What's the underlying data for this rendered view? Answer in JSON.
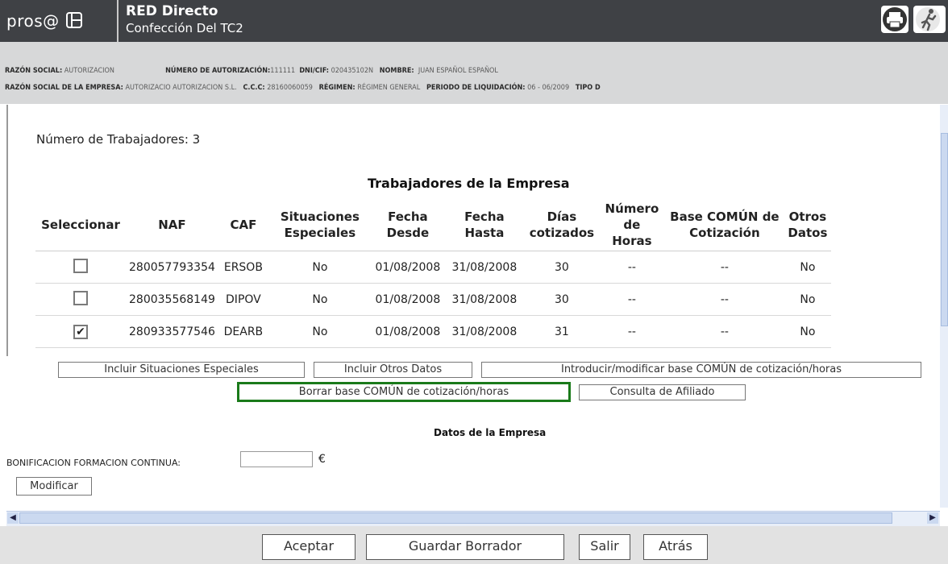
{
  "header": {
    "logo_text": "pros@",
    "title": "RED Directo",
    "subtitle": "Confección Del TC2"
  },
  "info": {
    "razon_social_label": "RAZÓN SOCIAL:",
    "razon_social_value": "AUTORIZACION",
    "num_autorizacion_label": "NÚMERO DE AUTORIZACIÓN:",
    "num_autorizacion_value": "111111",
    "dni_label": "DNI/CIF:",
    "dni_value": "020435102N",
    "nombre_label": "NOMBRE:",
    "nombre_value": "JUAN ESPAÑOL ESPAÑOL",
    "razon_empresa_label": "RAZÓN SOCIAL DE LA EMPRESA:",
    "razon_empresa_value": "AUTORIZACIO AUTORIZACION  S.L.",
    "ccc_label": "C.C.C:",
    "ccc_value": "28160060059",
    "regimen_label": "RÉGIMEN:",
    "regimen_value": "RÉGIMEN GENERAL",
    "periodo_label": "PERIODO DE LIQUIDACIÓN:",
    "periodo_value": "06 - 06/2009",
    "tipo_label": "TIPO D"
  },
  "main": {
    "worker_count": "Número de Trabajadores: 3",
    "table_title": "Trabajadores de la Empresa",
    "columns": [
      "Seleccionar",
      "NAF",
      "CAF",
      "Situaciones Especiales",
      "Fecha Desde",
      "Fecha Hasta",
      "Días cotizados",
      "Número de Horas",
      "Base COMÚN de Cotización",
      "Otros Datos"
    ],
    "rows": [
      {
        "checked": false,
        "naf": "280057793354",
        "caf": "ERSOB",
        "situaciones": "No",
        "desde": "01/08/2008",
        "hasta": "31/08/2008",
        "dias": "30",
        "horas": "--",
        "base": "--",
        "otros": "No"
      },
      {
        "checked": false,
        "naf": "280035568149",
        "caf": "DIPOV",
        "situaciones": "No",
        "desde": "01/08/2008",
        "hasta": "31/08/2008",
        "dias": "30",
        "horas": "--",
        "base": "--",
        "otros": "No"
      },
      {
        "checked": true,
        "naf": "280933577546",
        "caf": "DEARB",
        "situaciones": "No",
        "desde": "01/08/2008",
        "hasta": "31/08/2008",
        "dias": "31",
        "horas": "--",
        "base": "--",
        "otros": "No"
      }
    ],
    "check_mark": "✔",
    "buttons": {
      "incluir_situaciones": "Incluir Situaciones Especiales",
      "incluir_otros": "Incluir Otros Datos",
      "introducir_base": "Introducir/modificar base COMÚN de cotización/horas",
      "borrar_base": "Borrar base COMÚN de cotización/horas",
      "consulta_afiliado": "Consulta de Afiliado"
    },
    "empresa_title": "Datos de la Empresa",
    "bonif_label": "BONIFICACION FORMACION CONTINUA:",
    "bonif_value": "",
    "bonif_unit": "€",
    "modificar": "Modificar"
  },
  "footer": {
    "aceptar": "Aceptar",
    "guardar": "Guardar Borrador",
    "salir": "Salir",
    "atras": "Atrás"
  },
  "colors": {
    "header_bg": "#3f4145",
    "infobar_bg": "#d7d8d9",
    "highlight_border": "#1a7a1a",
    "footer_bg": "#e2e2e2"
  },
  "icons": {
    "print": "printer-icon",
    "exit": "exit-runner-icon"
  }
}
